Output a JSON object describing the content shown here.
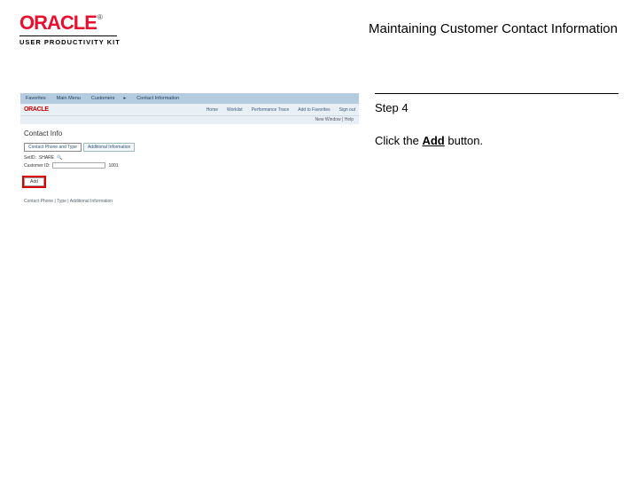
{
  "header": {
    "brand": "ORACLE",
    "tm": "®",
    "product": "USER PRODUCTIVITY KIT",
    "title": "Maintaining Customer Contact Information"
  },
  "shot": {
    "topbar": {
      "fav": "Favorites",
      "menu": "Main Menu",
      "sep": "▸",
      "crumb1": "Customers",
      "crumb2": "Contact Information"
    },
    "mini_brand": "ORACLE",
    "nav": {
      "home": "Home",
      "worklist": "Worklist",
      "perf": "Performance Trace",
      "add": "Add to Favorites",
      "out": "Sign out"
    },
    "status": "New Window | Help",
    "heading": "Contact Info",
    "tabs": {
      "t1": "Contact Phone and Type",
      "t2": "Additional Information"
    },
    "fields": {
      "setid_label": "SetID:",
      "setid_val": "SHARE",
      "cust_label": "Customer ID:",
      "cust_val": "1001"
    },
    "add_btn": "Add",
    "footer": "Contact Phone | Type | Additional Information"
  },
  "instr": {
    "step": "Step 4",
    "pre": "Click the ",
    "bold": "Add",
    "post": " button."
  }
}
